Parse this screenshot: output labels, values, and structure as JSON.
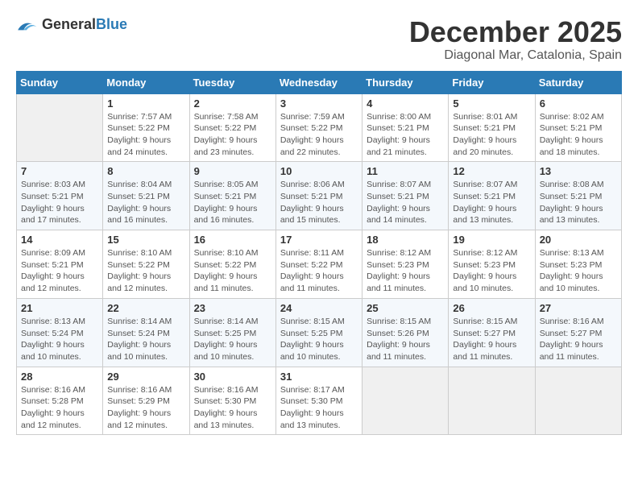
{
  "header": {
    "logo_general": "General",
    "logo_blue": "Blue",
    "month_title": "December 2025",
    "location": "Diagonal Mar, Catalonia, Spain"
  },
  "weekdays": [
    "Sunday",
    "Monday",
    "Tuesday",
    "Wednesday",
    "Thursday",
    "Friday",
    "Saturday"
  ],
  "weeks": [
    [
      {
        "day": "",
        "empty": true
      },
      {
        "day": "1",
        "sunrise": "Sunrise: 7:57 AM",
        "sunset": "Sunset: 5:22 PM",
        "daylight": "Daylight: 9 hours and 24 minutes."
      },
      {
        "day": "2",
        "sunrise": "Sunrise: 7:58 AM",
        "sunset": "Sunset: 5:22 PM",
        "daylight": "Daylight: 9 hours and 23 minutes."
      },
      {
        "day": "3",
        "sunrise": "Sunrise: 7:59 AM",
        "sunset": "Sunset: 5:22 PM",
        "daylight": "Daylight: 9 hours and 22 minutes."
      },
      {
        "day": "4",
        "sunrise": "Sunrise: 8:00 AM",
        "sunset": "Sunset: 5:21 PM",
        "daylight": "Daylight: 9 hours and 21 minutes."
      },
      {
        "day": "5",
        "sunrise": "Sunrise: 8:01 AM",
        "sunset": "Sunset: 5:21 PM",
        "daylight": "Daylight: 9 hours and 20 minutes."
      },
      {
        "day": "6",
        "sunrise": "Sunrise: 8:02 AM",
        "sunset": "Sunset: 5:21 PM",
        "daylight": "Daylight: 9 hours and 18 minutes."
      }
    ],
    [
      {
        "day": "7",
        "sunrise": "Sunrise: 8:03 AM",
        "sunset": "Sunset: 5:21 PM",
        "daylight": "Daylight: 9 hours and 17 minutes."
      },
      {
        "day": "8",
        "sunrise": "Sunrise: 8:04 AM",
        "sunset": "Sunset: 5:21 PM",
        "daylight": "Daylight: 9 hours and 16 minutes."
      },
      {
        "day": "9",
        "sunrise": "Sunrise: 8:05 AM",
        "sunset": "Sunset: 5:21 PM",
        "daylight": "Daylight: 9 hours and 16 minutes."
      },
      {
        "day": "10",
        "sunrise": "Sunrise: 8:06 AM",
        "sunset": "Sunset: 5:21 PM",
        "daylight": "Daylight: 9 hours and 15 minutes."
      },
      {
        "day": "11",
        "sunrise": "Sunrise: 8:07 AM",
        "sunset": "Sunset: 5:21 PM",
        "daylight": "Daylight: 9 hours and 14 minutes."
      },
      {
        "day": "12",
        "sunrise": "Sunrise: 8:07 AM",
        "sunset": "Sunset: 5:21 PM",
        "daylight": "Daylight: 9 hours and 13 minutes."
      },
      {
        "day": "13",
        "sunrise": "Sunrise: 8:08 AM",
        "sunset": "Sunset: 5:21 PM",
        "daylight": "Daylight: 9 hours and 13 minutes."
      }
    ],
    [
      {
        "day": "14",
        "sunrise": "Sunrise: 8:09 AM",
        "sunset": "Sunset: 5:21 PM",
        "daylight": "Daylight: 9 hours and 12 minutes."
      },
      {
        "day": "15",
        "sunrise": "Sunrise: 8:10 AM",
        "sunset": "Sunset: 5:22 PM",
        "daylight": "Daylight: 9 hours and 12 minutes."
      },
      {
        "day": "16",
        "sunrise": "Sunrise: 8:10 AM",
        "sunset": "Sunset: 5:22 PM",
        "daylight": "Daylight: 9 hours and 11 minutes."
      },
      {
        "day": "17",
        "sunrise": "Sunrise: 8:11 AM",
        "sunset": "Sunset: 5:22 PM",
        "daylight": "Daylight: 9 hours and 11 minutes."
      },
      {
        "day": "18",
        "sunrise": "Sunrise: 8:12 AM",
        "sunset": "Sunset: 5:23 PM",
        "daylight": "Daylight: 9 hours and 11 minutes."
      },
      {
        "day": "19",
        "sunrise": "Sunrise: 8:12 AM",
        "sunset": "Sunset: 5:23 PM",
        "daylight": "Daylight: 9 hours and 10 minutes."
      },
      {
        "day": "20",
        "sunrise": "Sunrise: 8:13 AM",
        "sunset": "Sunset: 5:23 PM",
        "daylight": "Daylight: 9 hours and 10 minutes."
      }
    ],
    [
      {
        "day": "21",
        "sunrise": "Sunrise: 8:13 AM",
        "sunset": "Sunset: 5:24 PM",
        "daylight": "Daylight: 9 hours and 10 minutes."
      },
      {
        "day": "22",
        "sunrise": "Sunrise: 8:14 AM",
        "sunset": "Sunset: 5:24 PM",
        "daylight": "Daylight: 9 hours and 10 minutes."
      },
      {
        "day": "23",
        "sunrise": "Sunrise: 8:14 AM",
        "sunset": "Sunset: 5:25 PM",
        "daylight": "Daylight: 9 hours and 10 minutes."
      },
      {
        "day": "24",
        "sunrise": "Sunrise: 8:15 AM",
        "sunset": "Sunset: 5:25 PM",
        "daylight": "Daylight: 9 hours and 10 minutes."
      },
      {
        "day": "25",
        "sunrise": "Sunrise: 8:15 AM",
        "sunset": "Sunset: 5:26 PM",
        "daylight": "Daylight: 9 hours and 11 minutes."
      },
      {
        "day": "26",
        "sunrise": "Sunrise: 8:15 AM",
        "sunset": "Sunset: 5:27 PM",
        "daylight": "Daylight: 9 hours and 11 minutes."
      },
      {
        "day": "27",
        "sunrise": "Sunrise: 8:16 AM",
        "sunset": "Sunset: 5:27 PM",
        "daylight": "Daylight: 9 hours and 11 minutes."
      }
    ],
    [
      {
        "day": "28",
        "sunrise": "Sunrise: 8:16 AM",
        "sunset": "Sunset: 5:28 PM",
        "daylight": "Daylight: 9 hours and 12 minutes."
      },
      {
        "day": "29",
        "sunrise": "Sunrise: 8:16 AM",
        "sunset": "Sunset: 5:29 PM",
        "daylight": "Daylight: 9 hours and 12 minutes."
      },
      {
        "day": "30",
        "sunrise": "Sunrise: 8:16 AM",
        "sunset": "Sunset: 5:30 PM",
        "daylight": "Daylight: 9 hours and 13 minutes."
      },
      {
        "day": "31",
        "sunrise": "Sunrise: 8:17 AM",
        "sunset": "Sunset: 5:30 PM",
        "daylight": "Daylight: 9 hours and 13 minutes."
      },
      {
        "day": "",
        "empty": true
      },
      {
        "day": "",
        "empty": true
      },
      {
        "day": "",
        "empty": true
      }
    ]
  ]
}
